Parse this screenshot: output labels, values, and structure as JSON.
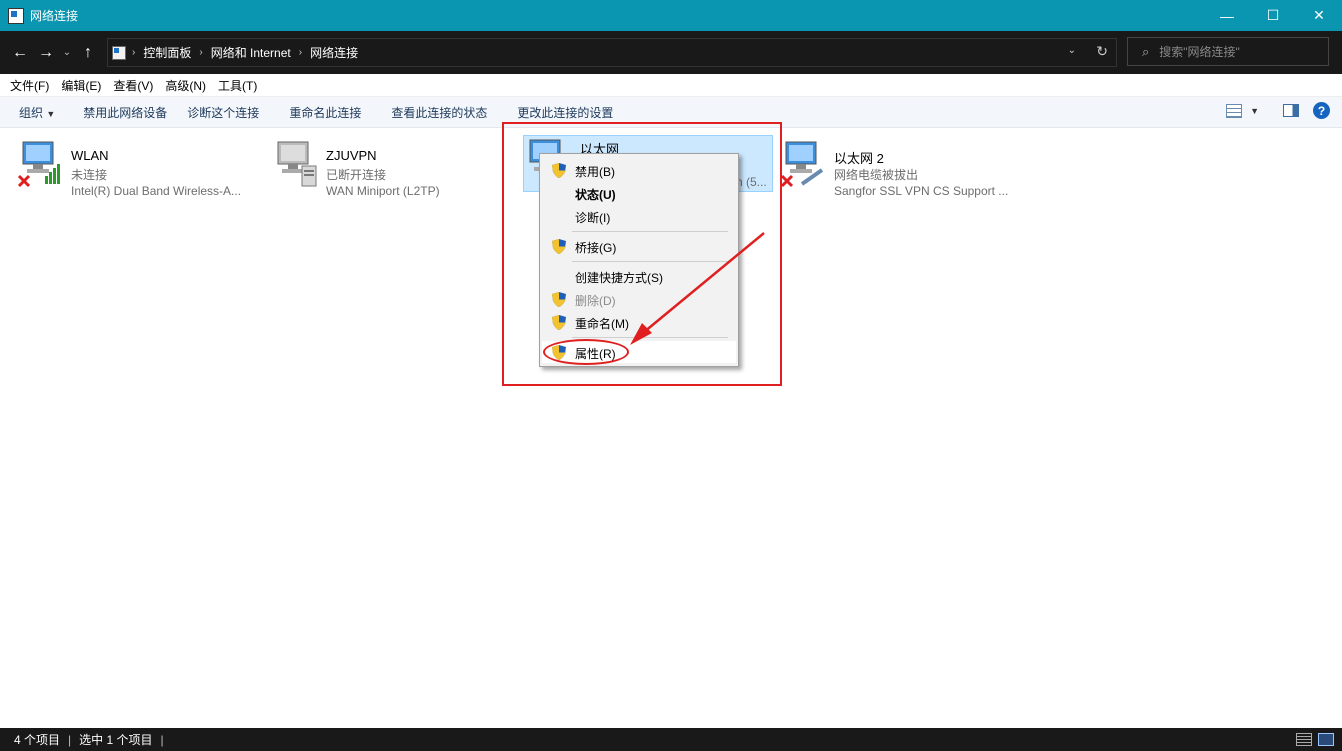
{
  "window": {
    "title": "网络连接",
    "buttons": {
      "minimize": "—",
      "maximize": "☐",
      "close": "✕"
    }
  },
  "address": {
    "back": "←",
    "forward": "→",
    "recent": "⌄",
    "up": "↑",
    "breadcrumb": [
      "控制面板",
      "网络和 Internet",
      "网络连接"
    ],
    "search_placeholder": "搜索\"网络连接\""
  },
  "menubar": [
    "文件(F)",
    "编辑(E)",
    "查看(V)",
    "高级(N)",
    "工具(T)"
  ],
  "commandbar": {
    "organize": "组织",
    "commands": [
      "禁用此网络设备",
      "诊断这个连接",
      "重命名此连接",
      "查看此连接的状态",
      "更改此连接的设置"
    ],
    "help": "?"
  },
  "connections": [
    {
      "name": "WLAN",
      "status": "未连接",
      "device": "Intel(R) Dual Band Wireless-A...",
      "icon": "wireless-network-icon",
      "error": true,
      "selected": false
    },
    {
      "name": "ZJUVPN",
      "status": "已断开连接",
      "device": "WAN Miniport (L2TP)",
      "icon": "vpn-network-icon",
      "error": false,
      "selected": false
    },
    {
      "name": "以太网",
      "status": "",
      "device": "n (5...",
      "icon": "ethernet-network-icon",
      "error": false,
      "selected": true
    },
    {
      "name": "以太网 2",
      "status": "网络电缆被拔出",
      "device": "Sangfor SSL VPN CS Support ...",
      "icon": "ethernet-network-icon",
      "error": true,
      "selected": false
    }
  ],
  "context_menu": {
    "items": [
      {
        "label": "禁用(B)",
        "shield": true,
        "bold": false,
        "disabled": false
      },
      {
        "label": "状态(U)",
        "shield": false,
        "bold": true,
        "disabled": false
      },
      {
        "label": "诊断(I)",
        "shield": false,
        "bold": false,
        "disabled": false
      },
      {
        "label": "桥接(G)",
        "shield": true,
        "bold": false,
        "disabled": false
      },
      {
        "label": "创建快捷方式(S)",
        "shield": false,
        "bold": false,
        "disabled": false
      },
      {
        "label": "删除(D)",
        "shield": true,
        "bold": false,
        "disabled": true
      },
      {
        "label": "重命名(M)",
        "shield": true,
        "bold": false,
        "disabled": false
      },
      {
        "label": "属性(R)",
        "shield": true,
        "bold": false,
        "disabled": false,
        "highlighted": true
      }
    ]
  },
  "statusbar": {
    "item_count": "4 个项目",
    "selected_count": "选中 1 个项目"
  },
  "colors": {
    "titlebar": "#0a96b0",
    "annotation_red": "#e02020",
    "selection": "#cce8ff"
  }
}
